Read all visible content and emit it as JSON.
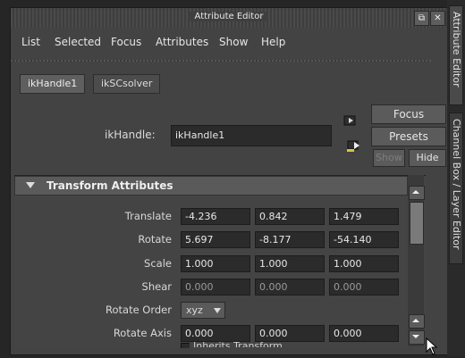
{
  "window": {
    "title": "Attribute Editor",
    "float_icon": "⧉",
    "close_icon": "✕"
  },
  "menu": {
    "items": [
      "List",
      "Selected",
      "Focus",
      "Attributes",
      "Show",
      "Help"
    ]
  },
  "tabs": [
    {
      "label": "ikHandle1"
    },
    {
      "label": "ikSCsolver"
    }
  ],
  "node": {
    "label": "ikHandle:",
    "value": "ikHandle1"
  },
  "buttons": {
    "focus": "Focus",
    "presets": "Presets",
    "show": "Show",
    "hide": "Hide"
  },
  "section": {
    "title": "Transform Attributes"
  },
  "attributes": {
    "translate": {
      "label": "Translate",
      "values": [
        "-4.236",
        "0.842",
        "1.479"
      ]
    },
    "rotate": {
      "label": "Rotate",
      "values": [
        "5.697",
        "-8.177",
        "-54.140"
      ]
    },
    "scale": {
      "label": "Scale",
      "values": [
        "1.000",
        "1.000",
        "1.000"
      ]
    },
    "shear": {
      "label": "Shear",
      "values": [
        "0.000",
        "0.000",
        "0.000"
      ]
    },
    "rotate_order": {
      "label": "Rotate Order",
      "value": "xyz"
    },
    "rotate_axis": {
      "label": "Rotate Axis",
      "values": [
        "0.000",
        "0.000",
        "0.000"
      ]
    },
    "inherits": {
      "label": "Inherits Transform"
    }
  },
  "side_tabs": {
    "attribute_editor": "Attribute Editor",
    "channel_box": "Channel Box / Layer Editor"
  },
  "colors": {
    "window_bg": "#434343",
    "field_bg": "#2b2b2b",
    "section_header": "#5a5a5a"
  }
}
